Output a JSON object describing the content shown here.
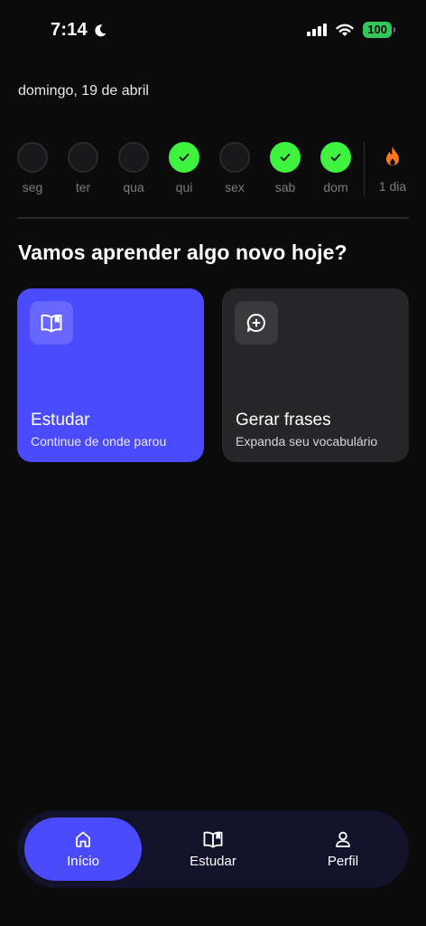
{
  "status_bar": {
    "time": "7:14",
    "battery": "100",
    "icons": [
      "moon-icon",
      "signal-icon",
      "wifi-icon",
      "battery-icon"
    ]
  },
  "date": "domingo, 19 de abril",
  "week": {
    "days": [
      {
        "label": "seg",
        "done": false
      },
      {
        "label": "ter",
        "done": false
      },
      {
        "label": "qua",
        "done": false
      },
      {
        "label": "qui",
        "done": true
      },
      {
        "label": "sex",
        "done": false
      },
      {
        "label": "sab",
        "done": true
      },
      {
        "label": "dom",
        "done": true
      }
    ],
    "streak": {
      "label": "1 dia",
      "icon": "flame-icon"
    }
  },
  "heading": "Vamos aprender algo novo hoje?",
  "cards": {
    "study": {
      "title": "Estudar",
      "subtitle": "Continue de onde parou",
      "icon": "book-icon"
    },
    "phrases": {
      "title": "Gerar frases",
      "subtitle": "Expanda seu vocabulário",
      "icon": "chat-plus-icon"
    }
  },
  "nav": {
    "home": "Início",
    "study": "Estudar",
    "profile": "Perfil"
  },
  "colors": {
    "background": "#0b0b0c",
    "accent": "#4a4aff",
    "done": "#3ef23e",
    "streak": "#ff7a1a",
    "nav_bg": "#12122a"
  }
}
